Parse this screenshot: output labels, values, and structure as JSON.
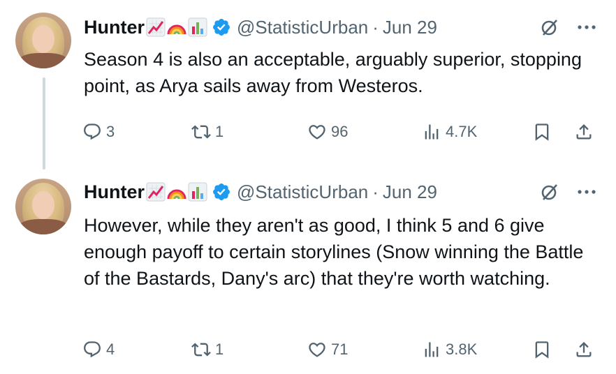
{
  "tweets": [
    {
      "author": "Hunter",
      "handle": "@StatisticUrban",
      "separator": "·",
      "date": "Jun 29",
      "text": "Season 4 is also an acceptable, arguably superior, stopping point, as Arya sails away from Westeros.",
      "replies": "3",
      "reposts": "1",
      "likes": "96",
      "views": "4.7K"
    },
    {
      "author": "Hunter",
      "handle": "@StatisticUrban",
      "separator": "·",
      "date": "Jun 29",
      "text": "However, while they aren't as good, I think 5 and 6 give enough payoff to certain storylines (Snow winning the Battle of the Bastards, Dany's arc) that they're worth watching.",
      "replies": "4",
      "reposts": "1",
      "likes": "71",
      "views": "3.8K"
    }
  ],
  "colors": {
    "text": "#0f1419",
    "secondary": "#536471",
    "verified": "#1d9bf0",
    "thread_line": "#cfd9de"
  },
  "icons": [
    "chart-increasing-emoji-icon",
    "rainbow-emoji-icon",
    "bar-chart-emoji-icon",
    "verified-badge-icon",
    "grok-icon",
    "more-icon",
    "reply-icon",
    "repost-icon",
    "like-icon",
    "views-icon",
    "bookmark-icon",
    "share-icon"
  ]
}
